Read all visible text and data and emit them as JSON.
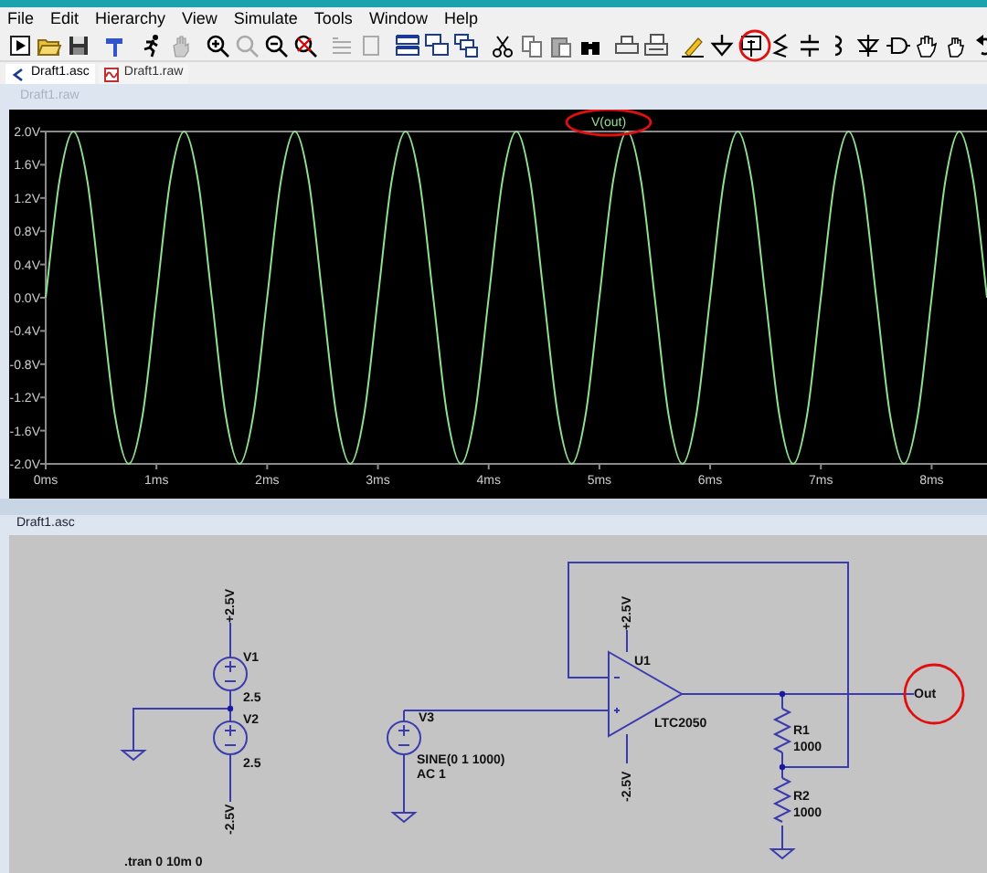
{
  "menu": [
    "File",
    "Edit",
    "Hierarchy",
    "View",
    "Simulate",
    "Tools",
    "Window",
    "Help"
  ],
  "tabs": [
    {
      "label": "Draft1.asc",
      "kind": "schematic",
      "selected": true
    },
    {
      "label": "Draft1.raw",
      "kind": "waveform",
      "selected": false
    }
  ],
  "plot_window": {
    "title": "Draft1.raw",
    "chart_data": {
      "type": "line",
      "x": [
        0,
        0.125,
        0.25,
        0.375,
        0.5,
        0.625,
        0.75,
        0.875,
        1,
        1.125,
        1.25,
        1.375,
        1.5,
        1.625,
        1.75,
        1.875,
        2,
        2.125,
        2.25,
        2.375,
        2.5,
        2.625,
        2.75,
        2.875,
        3,
        3.125,
        3.25,
        3.375,
        3.5,
        3.625,
        3.75,
        3.875,
        4,
        4.125,
        4.25,
        4.375,
        4.5,
        4.625,
        4.75,
        4.875,
        5,
        5.125,
        5.25,
        5.375,
        5.5,
        5.625,
        5.75,
        5.875,
        6,
        6.125,
        6.25,
        6.375,
        6.5,
        6.625,
        6.75,
        6.875,
        7,
        7.125,
        7.25,
        7.375,
        7.5,
        7.625,
        7.75,
        7.875,
        8,
        8.125,
        8.25,
        8.375,
        8.5
      ],
      "series": [
        {
          "name": "V(out)",
          "color": "#8fe08f",
          "values": [
            0,
            1.414,
            2,
            1.414,
            0,
            -1.414,
            -2,
            -1.414,
            0,
            1.414,
            2,
            1.414,
            0,
            -1.414,
            -2,
            -1.414,
            0,
            1.414,
            2,
            1.414,
            0,
            -1.414,
            -2,
            -1.414,
            0,
            1.414,
            2,
            1.414,
            0,
            -1.414,
            -2,
            -1.414,
            0,
            1.414,
            2,
            1.414,
            0,
            -1.414,
            -2,
            -1.414,
            0,
            1.414,
            2,
            1.414,
            0,
            -1.414,
            -2,
            -1.414,
            0,
            1.414,
            2,
            1.414,
            0,
            -1.414,
            -2,
            -1.414,
            0,
            1.414,
            2,
            1.414,
            0,
            -1.414,
            -2,
            -1.414,
            0,
            1.414,
            2,
            1.414,
            0
          ]
        }
      ],
      "xlim": [
        0,
        8.5
      ],
      "ylim": [
        -2,
        2
      ],
      "xticks": [
        {
          "value": 0,
          "label": "0ms"
        },
        {
          "value": 1,
          "label": "1ms"
        },
        {
          "value": 2,
          "label": "2ms"
        },
        {
          "value": 3,
          "label": "3ms"
        },
        {
          "value": 4,
          "label": "4ms"
        },
        {
          "value": 5,
          "label": "5ms"
        },
        {
          "value": 6,
          "label": "6ms"
        },
        {
          "value": 7,
          "label": "7ms"
        },
        {
          "value": 8,
          "label": "8ms"
        }
      ],
      "yticks": [
        {
          "value": 2,
          "label": "2.0V"
        },
        {
          "value": 1.6,
          "label": "1.6V"
        },
        {
          "value": 1.2,
          "label": "1.2V"
        },
        {
          "value": 0.8,
          "label": "0.8V"
        },
        {
          "value": 0.4,
          "label": "0.4V"
        },
        {
          "value": 0,
          "label": "0.0V"
        },
        {
          "value": -0.4,
          "label": "-0.4V"
        },
        {
          "value": -0.8,
          "label": "-0.8V"
        },
        {
          "value": -1.2,
          "label": "-1.2V"
        },
        {
          "value": -1.6,
          "label": "-1.6V"
        },
        {
          "value": -2,
          "label": "-2.0V"
        }
      ]
    }
  },
  "schematic_window": {
    "title": "Draft1.asc",
    "sources": [
      {
        "name": "V1",
        "value": "2.5"
      },
      {
        "name": "V2",
        "value": "2.5"
      },
      {
        "name": "V3",
        "value": "SINE(0 1 1000)",
        "ac": "AC 1"
      }
    ],
    "opamp": {
      "name": "U1",
      "model": "LTC2050"
    },
    "resistors": [
      {
        "name": "R1",
        "value": "1000"
      },
      {
        "name": "R2",
        "value": "1000"
      }
    ],
    "net_labels": [
      "+2.5V",
      "-2.5V",
      "+2.5V",
      "-2.5V",
      "Out"
    ],
    "directive": ".tran 0 10m 0"
  }
}
